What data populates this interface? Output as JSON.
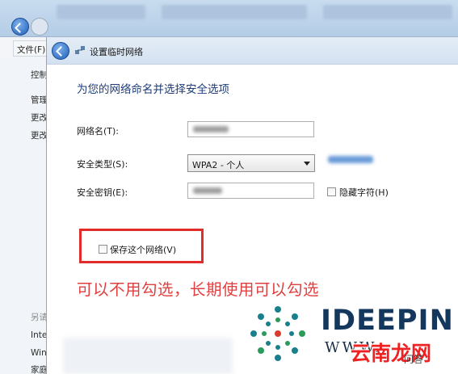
{
  "background_window": {
    "menu_file_label": "文件(F)",
    "side_items": [
      {
        "label": "控制"
      },
      {
        "label": "管理"
      },
      {
        "label": "更改"
      },
      {
        "label": "更改"
      },
      {
        "label": "另请参阅"
      },
      {
        "label": "Internet 选项"
      },
      {
        "label": "Windows 防火墙"
      },
      {
        "label": "家庭组"
      }
    ]
  },
  "dialog": {
    "title": "设置临时网络",
    "heading": "为您的网络命名并选择安全选项",
    "network_name_label": "网络名(T):",
    "security_type_label": "安全类型(S):",
    "security_type_value": "WPA2 - 个人",
    "security_key_label": "安全密钥(E):",
    "hide_chars_label": "隐藏字符(H)",
    "save_network_label": "保存这个网络(V)"
  },
  "annotation": {
    "text": "可以不用勾选，长期使用可以勾选",
    "color": "#df3f3f"
  },
  "watermark": {
    "brand": "IDEEPIN",
    "url_prefix": "WWW.",
    "site_name": "云南龙网",
    "small_text": "问答"
  }
}
